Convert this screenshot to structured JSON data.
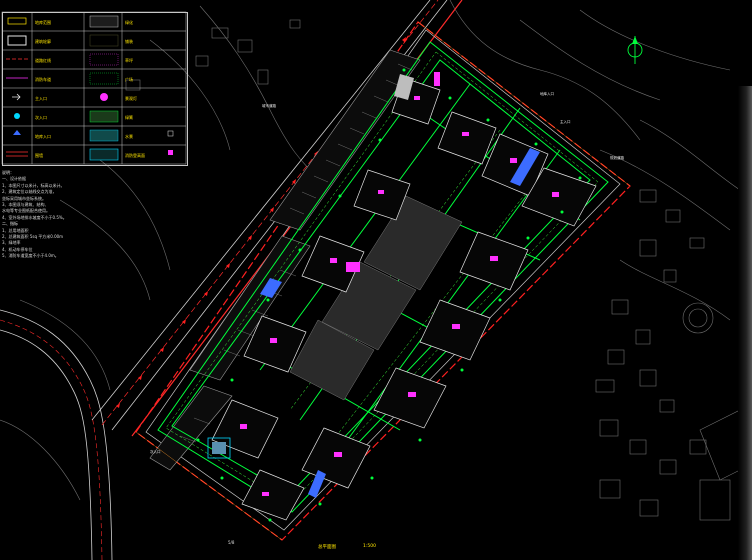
{
  "drawing": {
    "title": "总平面图",
    "scale": "1:500",
    "page_no": "5/8"
  },
  "legend": {
    "rows": [
      {
        "left": "地库范围",
        "right": "绿化"
      },
      {
        "left": "建筑轮廓",
        "right": "铺装"
      },
      {
        "left": "道路红线",
        "right": "草坪"
      },
      {
        "left": "消防车道",
        "right": "广场"
      },
      {
        "left": "主入口",
        "right": "景观灯"
      },
      {
        "left": "次入口",
        "right": "绿篱"
      },
      {
        "left": "地库入口",
        "right": "水景"
      },
      {
        "left": "围墙",
        "right": "消防登高面"
      }
    ]
  },
  "notes": {
    "heading": "说明：",
    "lines": [
      "一、设计依据",
      "1、本图尺寸以米计，标高以米计。",
      "2、建筑定位以轴线交点为准，",
      "   坐标采用城市坐标系统。",
      "3、本图须与建筑、结构、",
      "   水电等专业图纸配合使用。",
      "4、室外场地排水坡度不小于0.5%。",
      "二、指标",
      "1、总用地面积",
      "2、总建筑面积      5sq   平方米0.00m",
      "3、绿地率",
      "4、机动车停车位",
      "5、消防车道宽度不小于4.0m。"
    ]
  },
  "labels": {
    "road_west": "城市道路",
    "north_gate": "主入口",
    "south_gate": "次入口",
    "east_road": "规划道路",
    "ramp": "地库入口"
  },
  "colors": {
    "background": "#000000",
    "site_boundary": "#ff2020",
    "green": "#00ff3c",
    "magenta": "#ff30ff",
    "yellow": "#ffe600",
    "cyan": "#00d8ff",
    "white": "#e6e6e6",
    "grey": "#7a7a7a",
    "blue": "#3c6cff"
  },
  "icons": {
    "compass": "north-arrow-icon"
  }
}
